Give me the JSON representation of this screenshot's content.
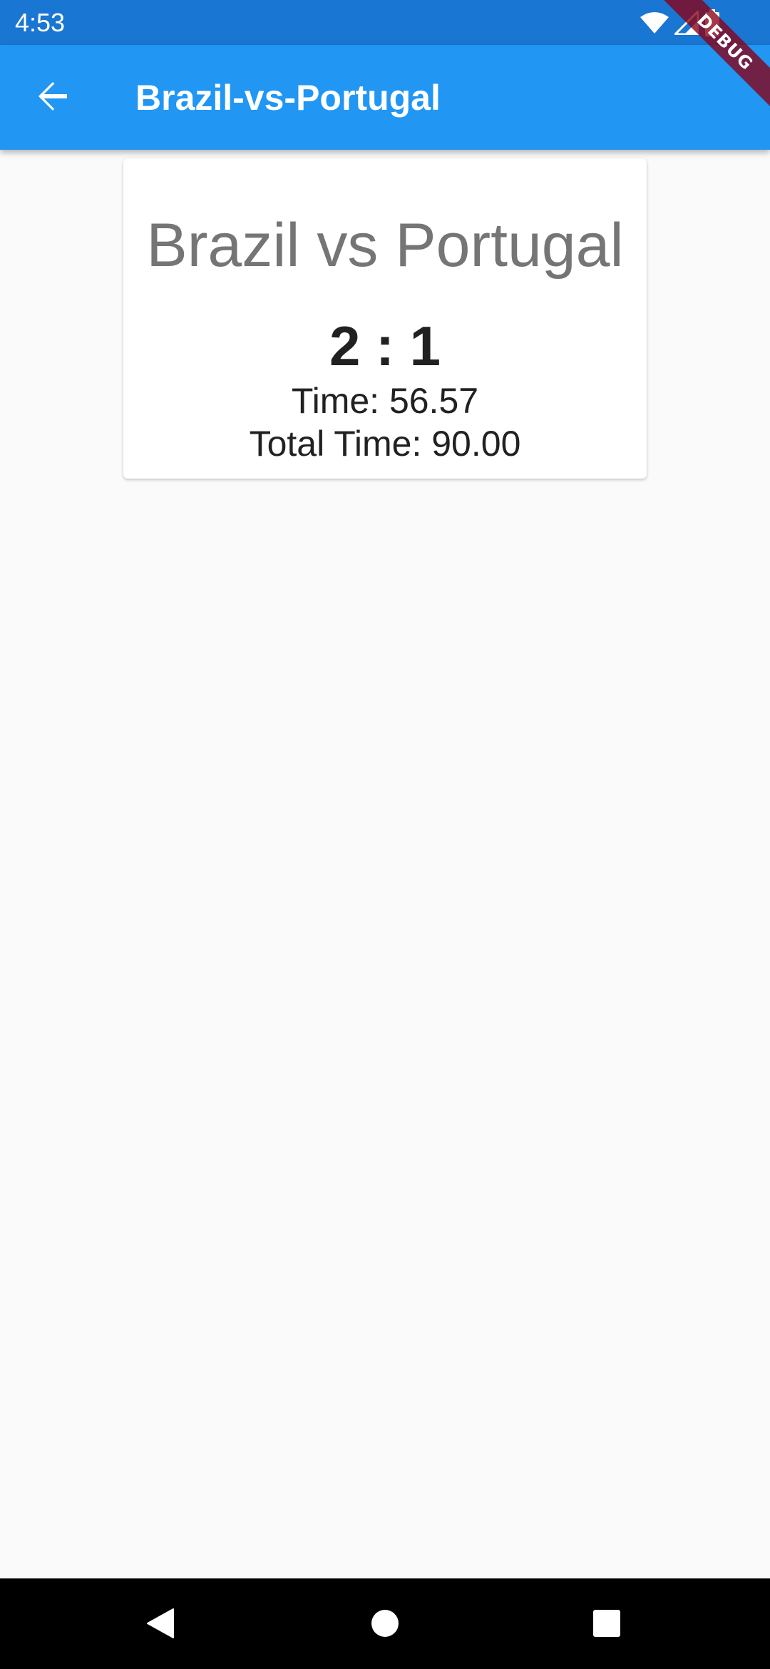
{
  "status_bar": {
    "time": "4:53",
    "icons": [
      "wifi-icon",
      "cellular-signal-icon",
      "battery-icon"
    ]
  },
  "debug_banner": {
    "label": "DEBUG"
  },
  "app_bar": {
    "title": "Brazil-vs-Portugal",
    "back_icon": "arrow-back-icon",
    "color": "#2196f3"
  },
  "match": {
    "title": "Brazil vs Portugal",
    "score": "2 : 1",
    "time": "Time: 56.57",
    "total_time": "Total Time: 90.00"
  },
  "nav_bar": {
    "buttons": [
      "nav-back-icon",
      "nav-home-icon",
      "nav-recents-icon"
    ]
  },
  "colors": {
    "status_bar": "#1976d2",
    "app_bar": "#2196f3",
    "background": "#fafafa",
    "title_text": "#757575",
    "body_text": "#212121"
  }
}
